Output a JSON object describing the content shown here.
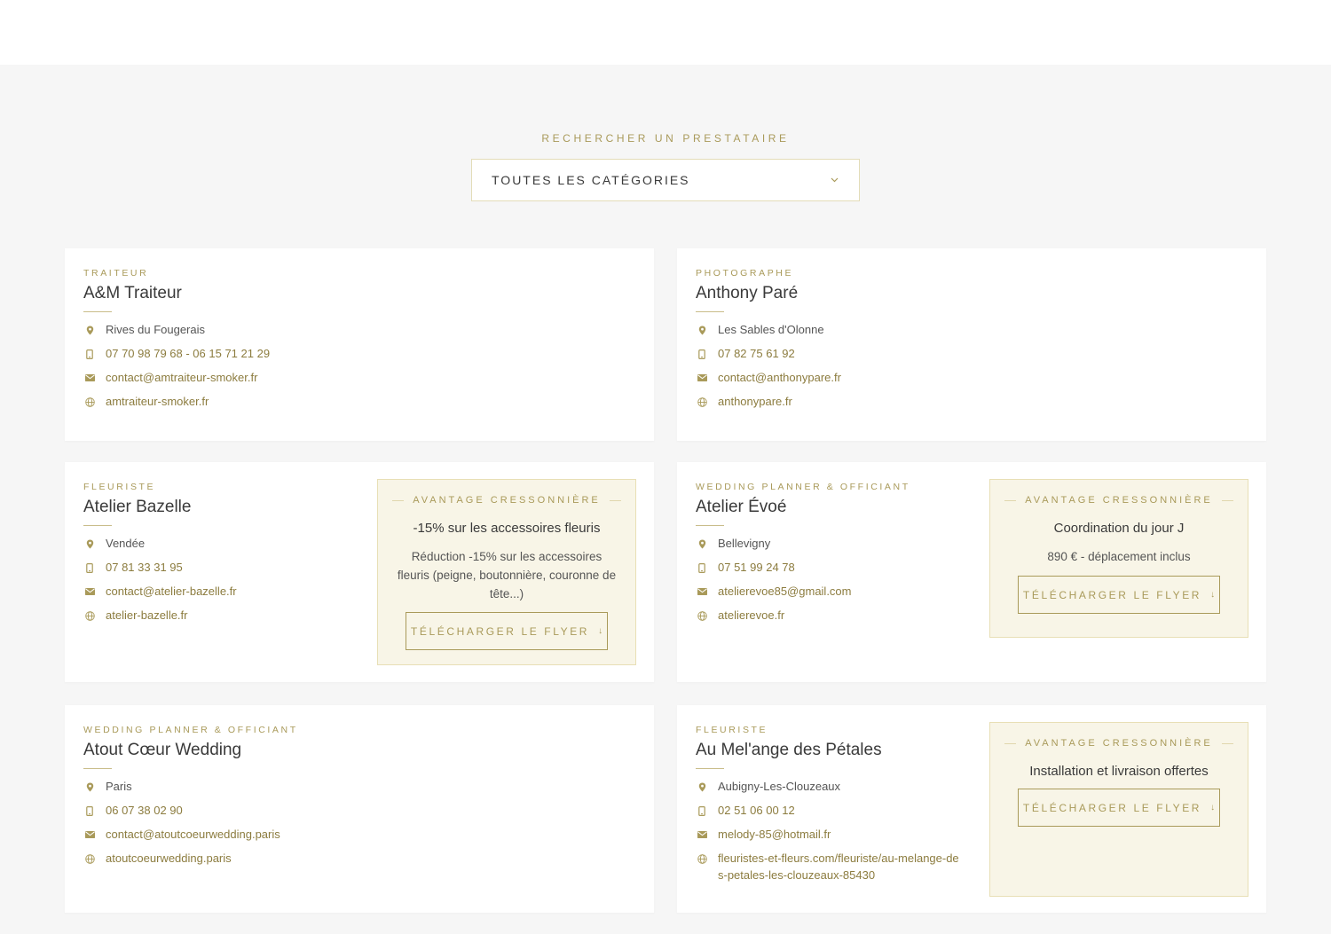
{
  "search": {
    "title": "RECHERCHER UN PRESTATAIRE",
    "select_value": "TOUTES LES CATÉGORIES"
  },
  "theme": {
    "accent": "#a99a5a",
    "link": "#8c7c3f",
    "perk_bg": "#f8f5e7",
    "page_bg": "#f6f6f6"
  },
  "perk_header": "AVANTAGE CRESSONNIÈRE",
  "flyer_label": "TÉLÉCHARGER LE FLYER",
  "flyer_arrow": "↓",
  "icons": [
    "map-pin-icon",
    "phone-icon",
    "mail-icon",
    "globe-icon",
    "chevron-down-icon",
    "download-arrow-icon"
  ],
  "vendors": [
    {
      "category": "TRAITEUR",
      "name": "A&M Traiteur",
      "location": "Rives du Fougerais",
      "phone": "07 70 98 79 68 - 06 15 71 21 29",
      "email": "contact@amtraiteur-smoker.fr",
      "website": "amtraiteur-smoker.fr"
    },
    {
      "category": "PHOTOGRAPHE",
      "name": "Anthony Paré",
      "location": "Les Sables d'Olonne",
      "phone": "07 82 75 61 92",
      "email": "contact@anthonypare.fr",
      "website": "anthonypare.fr"
    },
    {
      "category": "FLEURISTE",
      "name": "Atelier Bazelle",
      "location": "Vendée",
      "phone": "07 81 33 31 95",
      "email": "contact@atelier-bazelle.fr",
      "website": "atelier-bazelle.fr",
      "perk": {
        "title": "-15% sur les accessoires fleuris",
        "desc": "Réduction -15% sur les accessoires fleuris (peigne, boutonnière, couronne de tête...)"
      }
    },
    {
      "category": "WEDDING PLANNER & OFFICIANT",
      "name": "Atelier Évoé",
      "location": "Bellevigny",
      "phone": "07 51 99 24 78",
      "email": "atelierevoe85@gmail.com",
      "website": "atelierevoe.fr",
      "perk": {
        "title": "Coordination du jour J",
        "desc": "890 € - déplacement inclus"
      }
    },
    {
      "category": "WEDDING PLANNER & OFFICIANT",
      "name": "Atout Cœur Wedding",
      "location": "Paris",
      "phone": "06 07 38 02 90",
      "email": "contact@atoutcoeurwedding.paris",
      "website": "atoutcoeurwedding.paris"
    },
    {
      "category": "FLEURISTE",
      "name": "Au Mel'ange des Pétales",
      "location": "Aubigny-Les-Clouzeaux",
      "phone": "02 51 06 00 12",
      "email": "melody-85@hotmail.fr",
      "website": "fleuristes-et-fleurs.com/fleuriste/au-melange-des-petales-les-clouzeaux-85430",
      "perk": {
        "title": "Installation et livraison offertes"
      }
    }
  ]
}
